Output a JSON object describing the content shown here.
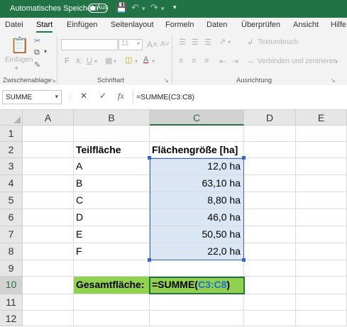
{
  "titlebar": {
    "autosave_label": "Automatisches Speichern",
    "autosave_state": "Aus",
    "accent": "#217346"
  },
  "ribbon": {
    "tabs": [
      "Datei",
      "Start",
      "Einfügen",
      "Seitenlayout",
      "Formeln",
      "Daten",
      "Überprüfen",
      "Ansicht",
      "Hilfe"
    ],
    "active_tab": "Start",
    "paste_label": "Einfügen",
    "font_size": "11",
    "wrap_text_label": "Textumbruch",
    "merge_label": "Verbinden und zentrieren",
    "groups": [
      "Zwischenablage",
      "Schriftart",
      "Ausrichtung"
    ]
  },
  "formula_bar": {
    "name_box": "SUMME",
    "formula": "=SUMME(C3:C8)",
    "cancel_icon": "✕",
    "enter_icon": "✓",
    "fx_icon": "fx"
  },
  "grid": {
    "columns": [
      "A",
      "B",
      "C",
      "D",
      "E"
    ],
    "rows": [
      "1",
      "2",
      "3",
      "4",
      "5",
      "6",
      "7",
      "8",
      "9",
      "10",
      "11",
      "12"
    ],
    "header_b": "Teilfläche",
    "header_c": "Flächengröße [ha]",
    "labels": [
      "A",
      "B",
      "C",
      "D",
      "E",
      "F"
    ],
    "values": [
      "12,0 ha",
      "63,10 ha",
      "8,80 ha",
      "46,0 ha",
      "50,50 ha",
      "22,0 ha"
    ],
    "total_label": "Gesamtfläche:",
    "total_formula_prefix": "=SUMME(",
    "total_formula_ref": "C3:C8",
    "total_formula_suffix": ")",
    "highlight_color": "#92d050",
    "range_fill": "#dbe6f4"
  }
}
